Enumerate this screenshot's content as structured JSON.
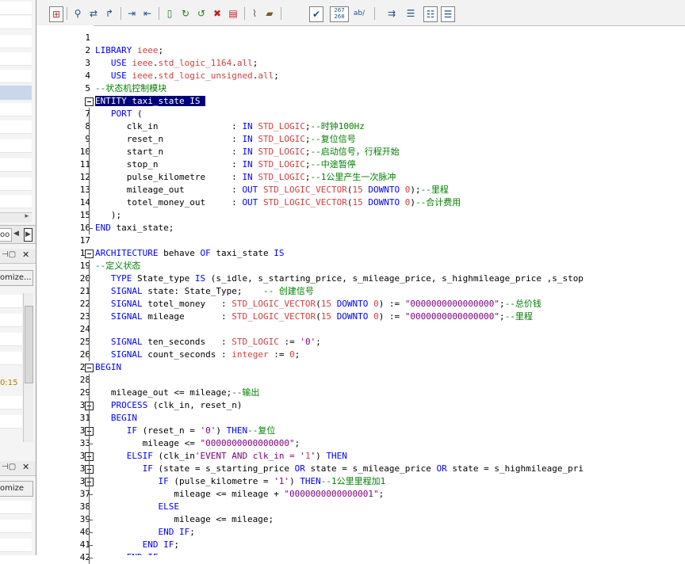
{
  "left_panel": {
    "tab_partial_label": "oo",
    "customize_button": "omize...",
    "customize_button_2": "omize",
    "time_partial": "0:15"
  },
  "toolbar": {
    "icons": [
      "find-icon",
      "find-replace-icon",
      "goto-icon",
      "indent-icon",
      "outdent-icon",
      "bookmark-toggle-icon",
      "bookmark-next-icon",
      "bookmark-prev-icon",
      "bookmark-clear-icon",
      "bookmark-list-icon",
      "attach-icon",
      "script-icon",
      "check-icon",
      "column-counter-icon",
      "word-wrap-icon",
      "step-icon",
      "view-toggle-1-icon",
      "view-toggle-2-icon",
      "view-toggle-3-icon"
    ],
    "counter_top": "267",
    "counter_bottom": "268",
    "wrap_label": "ab/"
  },
  "editor": {
    "lines": [
      {
        "n": "1",
        "t": ""
      },
      {
        "n": "2",
        "t": "LIBRARY ieee;"
      },
      {
        "n": "3",
        "t": "   USE ieee.std_logic_1164.all;"
      },
      {
        "n": "4",
        "t": "   USE ieee.std_logic_unsigned.all;"
      },
      {
        "n": "5",
        "t": "--状态机控制模块"
      },
      {
        "n": "6",
        "t": "ENTITY taxi_state IS "
      },
      {
        "n": "7",
        "t": "   PORT ("
      },
      {
        "n": "8",
        "t": "      clk_in              : IN STD_LOGIC;--时钟100Hz"
      },
      {
        "n": "9",
        "t": "      reset_n             : IN STD_LOGIC;--复位信号"
      },
      {
        "n": "10",
        "t": "      start_n             : IN STD_LOGIC;--启动信号，行程开始"
      },
      {
        "n": "11",
        "t": "      stop_n              : IN STD_LOGIC;--中途暂停"
      },
      {
        "n": "12",
        "t": "      pulse_kilometre     : IN STD_LOGIC;--1公里产生一次脉冲"
      },
      {
        "n": "13",
        "t": "      mileage_out         : OUT STD_LOGIC_VECTOR(15 DOWNTO 0);--里程"
      },
      {
        "n": "14",
        "t": "      totel_money_out     : OUT STD_LOGIC_VECTOR(15 DOWNTO 0)--合计费用"
      },
      {
        "n": "15",
        "t": "   );"
      },
      {
        "n": "16",
        "t": "END taxi_state;"
      },
      {
        "n": "17",
        "t": ""
      },
      {
        "n": "18",
        "t": "ARCHITECTURE behave OF taxi_state IS"
      },
      {
        "n": "19",
        "t": "--定义状态"
      },
      {
        "n": "20",
        "t": "   TYPE State_type IS (s_idle, s_starting_price, s_mileage_price, s_highmileage_price ,s_stop"
      },
      {
        "n": "21",
        "t": "   SIGNAL state: State_Type;    -- 创建信号"
      },
      {
        "n": "22",
        "t": "   SIGNAL totel_money   : STD_LOGIC_VECTOR(15 DOWNTO 0) := \"0000000000000000\";--总价钱"
      },
      {
        "n": "23",
        "t": "   SIGNAL mileage       : STD_LOGIC_VECTOR(15 DOWNTO 0) := \"0000000000000000\";--里程"
      },
      {
        "n": "24",
        "t": ""
      },
      {
        "n": "25",
        "t": "   SIGNAL ten_seconds   : STD_LOGIC := '0';"
      },
      {
        "n": "26",
        "t": "   SIGNAL count_seconds : integer := 0;"
      },
      {
        "n": "27",
        "t": "BEGIN"
      },
      {
        "n": "28",
        "t": ""
      },
      {
        "n": "29",
        "t": "   mileage_out <= mileage;--输出"
      },
      {
        "n": "30",
        "t": "   PROCESS (clk_in, reset_n)"
      },
      {
        "n": "31",
        "t": "   BEGIN"
      },
      {
        "n": "32",
        "t": "      IF (reset_n = '0') THEN--复位"
      },
      {
        "n": "33",
        "t": "         mileage <= \"0000000000000000\";"
      },
      {
        "n": "34",
        "t": "      ELSIF (clk_in'EVENT AND clk_in = '1') THEN"
      },
      {
        "n": "35",
        "t": "         IF (state = s_starting_price OR state = s_mileage_price OR state = s_highmileage_pri"
      },
      {
        "n": "36",
        "t": "            IF (pulse_kilometre = '1') THEN--1公里里程加1"
      },
      {
        "n": "37",
        "t": "               mileage <= mileage + \"0000000000000001\";"
      },
      {
        "n": "38",
        "t": "            ELSE"
      },
      {
        "n": "39",
        "t": "               mileage <= mileage;"
      },
      {
        "n": "40",
        "t": "            END IF;"
      },
      {
        "n": "41",
        "t": "         END IF;"
      },
      {
        "n": "42",
        "t": "      END IF;"
      }
    ]
  },
  "colors": {
    "keyword": "#0000ff",
    "type": "#d04040",
    "comment": "#008000",
    "string": "#800080",
    "selection": "#00007a"
  }
}
